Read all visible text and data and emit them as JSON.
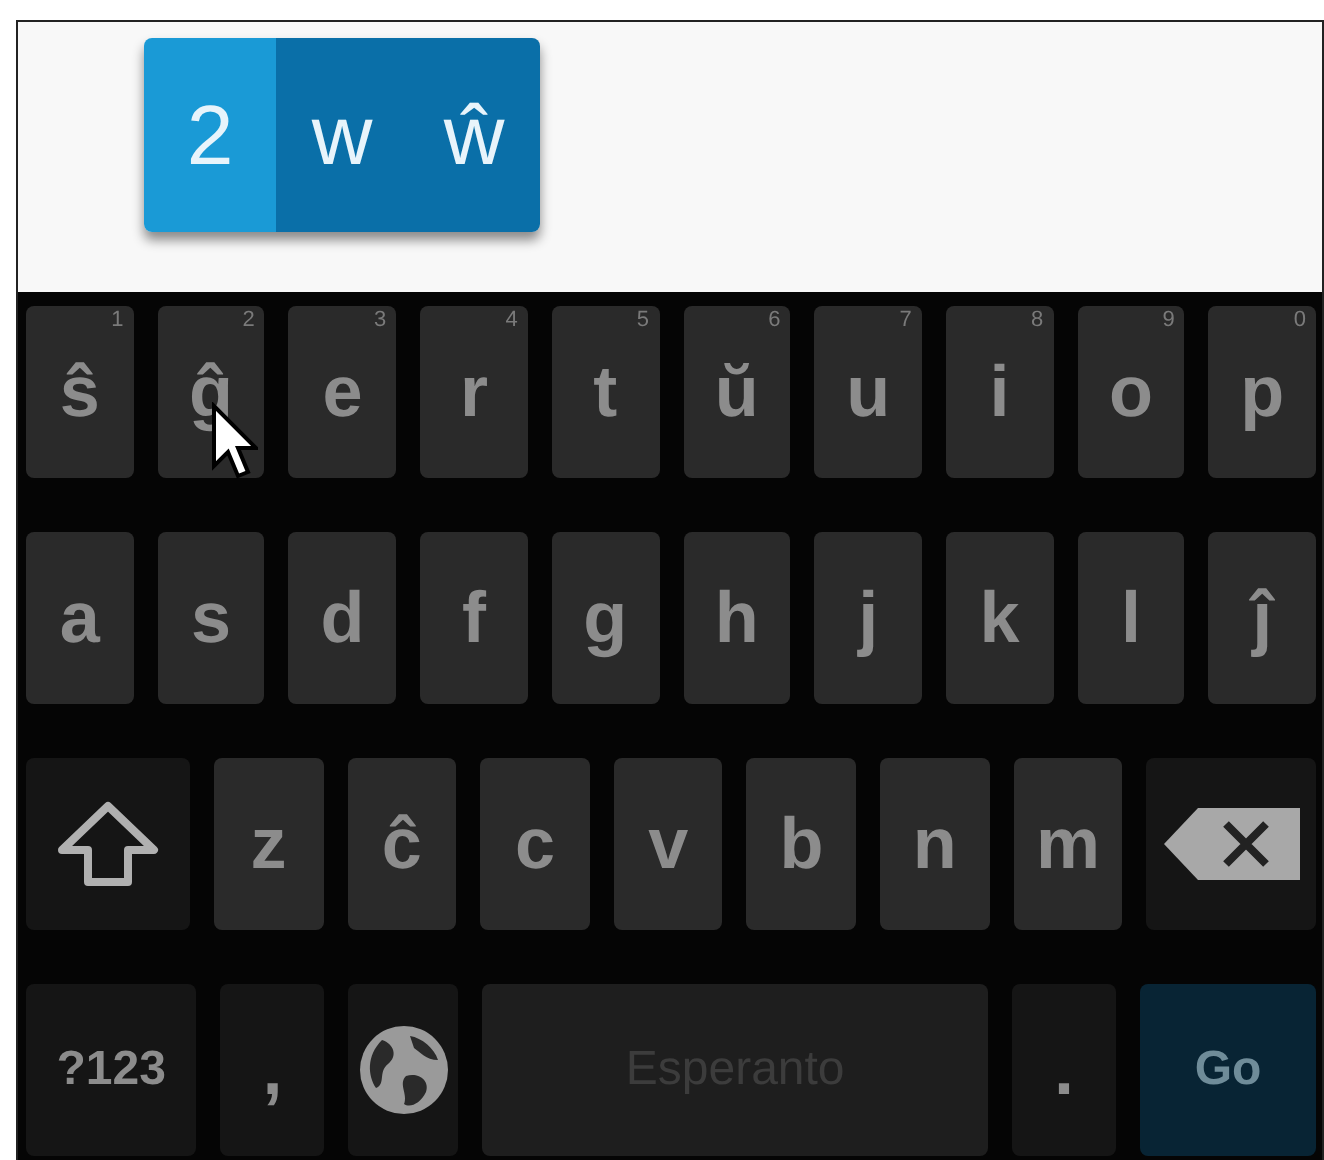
{
  "popup": {
    "keys": [
      {
        "label": "2",
        "selected": true
      },
      {
        "label": "w",
        "selected": false
      },
      {
        "label": "ŵ",
        "selected": false
      }
    ]
  },
  "rows": [
    {
      "keys": [
        {
          "kind": "letter",
          "label": "ŝ",
          "hint": "1"
        },
        {
          "kind": "letter",
          "label": "ĝ",
          "hint": "2"
        },
        {
          "kind": "letter",
          "label": "e",
          "hint": "3"
        },
        {
          "kind": "letter",
          "label": "r",
          "hint": "4"
        },
        {
          "kind": "letter",
          "label": "t",
          "hint": "5"
        },
        {
          "kind": "letter",
          "label": "ŭ",
          "hint": "6"
        },
        {
          "kind": "letter",
          "label": "u",
          "hint": "7"
        },
        {
          "kind": "letter",
          "label": "i",
          "hint": "8"
        },
        {
          "kind": "letter",
          "label": "o",
          "hint": "9"
        },
        {
          "kind": "letter",
          "label": "p",
          "hint": "0"
        }
      ]
    },
    {
      "keys": [
        {
          "kind": "letter",
          "label": "a"
        },
        {
          "kind": "letter",
          "label": "s"
        },
        {
          "kind": "letter",
          "label": "d"
        },
        {
          "kind": "letter",
          "label": "f"
        },
        {
          "kind": "letter",
          "label": "g"
        },
        {
          "kind": "letter",
          "label": "h"
        },
        {
          "kind": "letter",
          "label": "j"
        },
        {
          "kind": "letter",
          "label": "k"
        },
        {
          "kind": "letter",
          "label": "l"
        },
        {
          "kind": "letter",
          "label": "ĵ"
        }
      ]
    },
    {
      "keys": [
        {
          "kind": "shift"
        },
        {
          "kind": "letter",
          "label": "z"
        },
        {
          "kind": "letter",
          "label": "ĉ"
        },
        {
          "kind": "letter",
          "label": "c"
        },
        {
          "kind": "letter",
          "label": "v"
        },
        {
          "kind": "letter",
          "label": "b"
        },
        {
          "kind": "letter",
          "label": "n"
        },
        {
          "kind": "letter",
          "label": "m"
        },
        {
          "kind": "backspace"
        }
      ]
    },
    {
      "keys": [
        {
          "kind": "mode",
          "label": "?123"
        },
        {
          "kind": "punct",
          "label": ","
        },
        {
          "kind": "globe"
        },
        {
          "kind": "space",
          "label": "Esperanto"
        },
        {
          "kind": "punct",
          "label": "."
        },
        {
          "kind": "action",
          "label": "Go"
        }
      ]
    }
  ]
}
